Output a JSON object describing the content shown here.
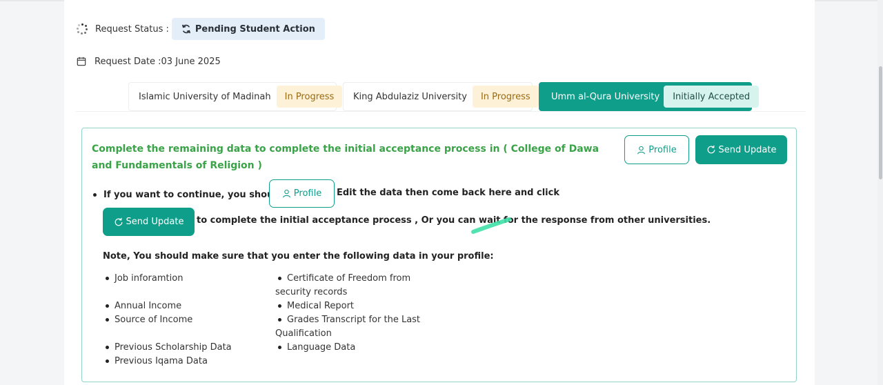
{
  "status": {
    "label": "Request Status :",
    "value": "Pending Student Action"
  },
  "request_date": {
    "label": "Request Date :",
    "value": "03 June 2025"
  },
  "universities": [
    {
      "name": "Islamic University of Madinah",
      "status": "In Progress"
    },
    {
      "name": "King Abdulaziz University",
      "status": "In Progress"
    },
    {
      "name": "Umm al-Qura University",
      "status": "Initially Accepted"
    }
  ],
  "panel": {
    "title": "Complete the remaining data to complete the initial acceptance process in ( College of Dawa and Fundamentals of Religion )",
    "profile_button": "Profile",
    "send_update_button": "Send Update",
    "instruction_part1": "If you want to continue, you should go to",
    "instruction_part2": "Edit the data then come back here and click",
    "instruction_part3": "to complete the initial acceptance process , Or you can wait for the response from other universities.",
    "note": "Note, You should make sure that you enter the following data in your profile:",
    "required_left": [
      "Job inforamtion",
      "Annual Income",
      "Source of Income",
      "Previous Scholarship Data",
      "Previous Iqama Data"
    ],
    "required_right": [
      "Certificate of Freedom from security records",
      "Medical Report",
      "Grades Transcript for the Last Qualification",
      "Language Data"
    ]
  },
  "colors": {
    "accent": "#0f9e8a",
    "title_green": "#3aa348",
    "progress_bg": "#fdf2d8",
    "accepted_bg": "#d6f3ee",
    "pending_bg": "#e3eef9"
  }
}
